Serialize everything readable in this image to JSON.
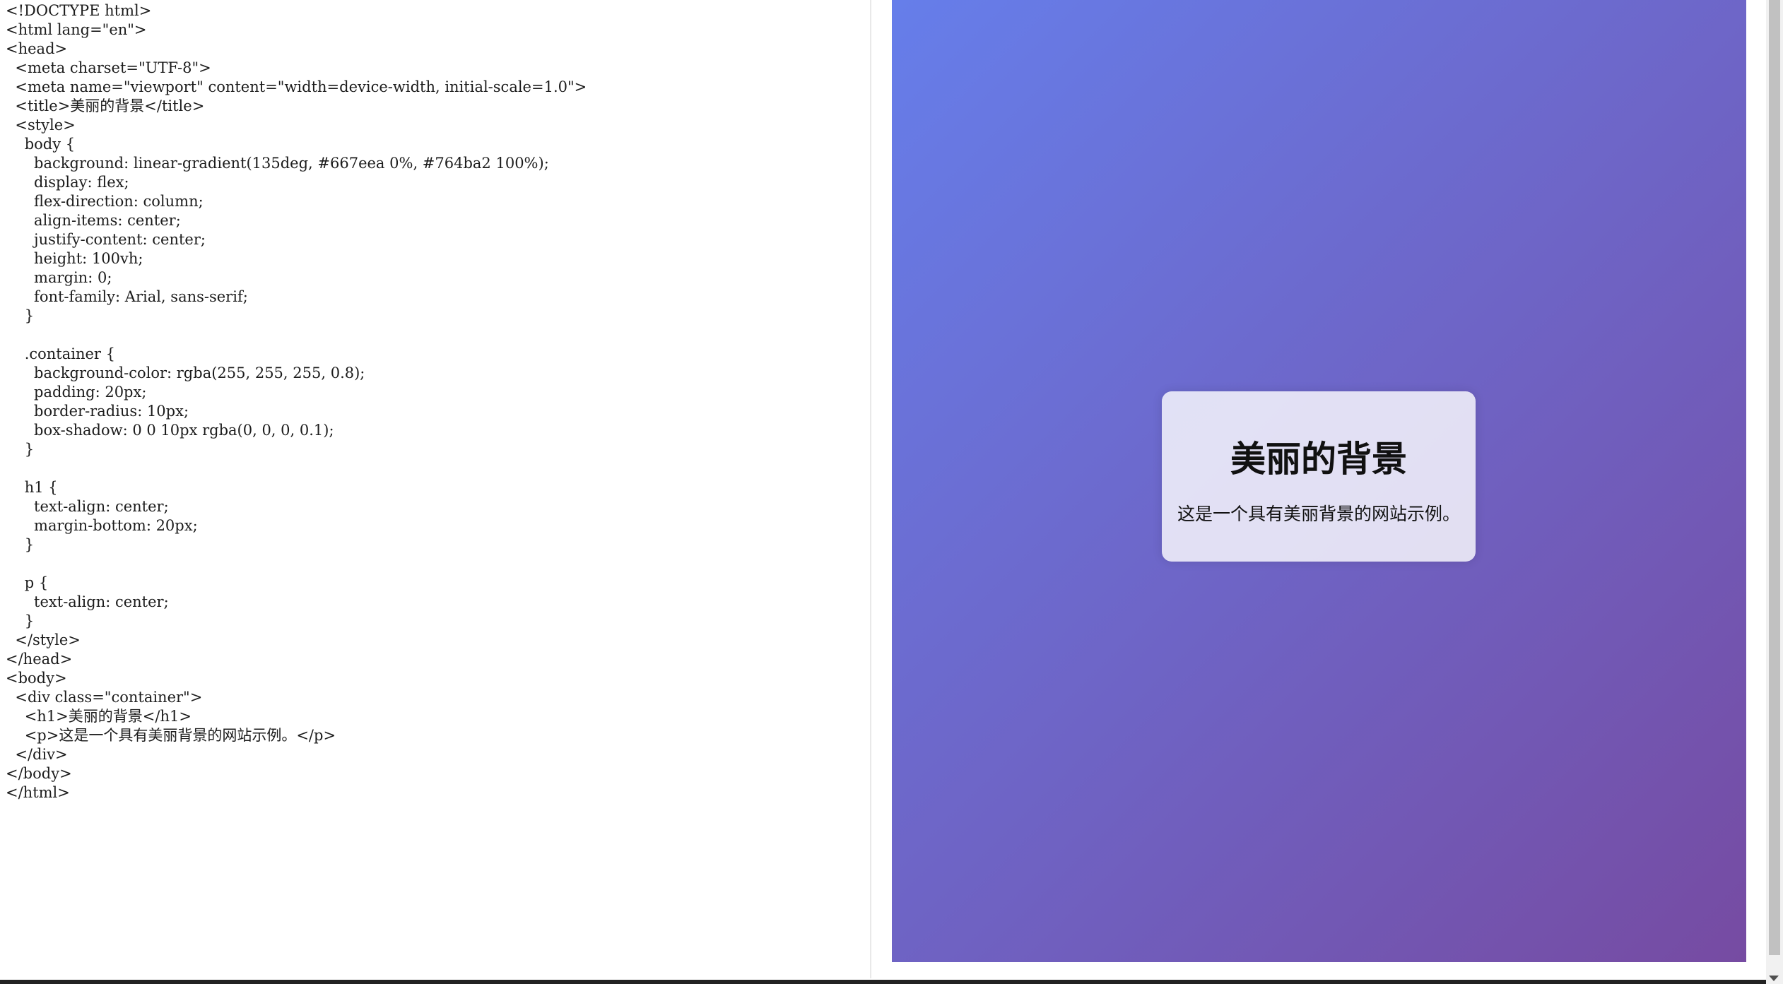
{
  "editor": {
    "lines": [
      "<!DOCTYPE html>",
      "<html lang=\"en\">",
      "<head>",
      "  <meta charset=\"UTF-8\">",
      "  <meta name=\"viewport\" content=\"width=device-width, initial-scale=1.0\">",
      "  <title>美丽的背景</title>",
      "  <style>",
      "    body {",
      "      background: linear-gradient(135deg, #667eea 0%, #764ba2 100%);",
      "      display: flex;",
      "      flex-direction: column;",
      "      align-items: center;",
      "      justify-content: center;",
      "      height: 100vh;",
      "      margin: 0;",
      "      font-family: Arial, sans-serif;",
      "    }",
      "",
      "    .container {",
      "      background-color: rgba(255, 255, 255, 0.8);",
      "      padding: 20px;",
      "      border-radius: 10px;",
      "      box-shadow: 0 0 10px rgba(0, 0, 0, 0.1);",
      "    }",
      "",
      "    h1 {",
      "      text-align: center;",
      "      margin-bottom: 20px;",
      "    }",
      "",
      "    p {",
      "      text-align: center;",
      "    }",
      "  </style>",
      "</head>",
      "<body>",
      "  <div class=\"container\">",
      "    <h1>美丽的背景</h1>",
      "    <p>这是一个具有美丽背景的网站示例。</p>",
      "  </div>",
      "</body>",
      "</html>"
    ]
  },
  "preview": {
    "gradient_start": "#667eea",
    "gradient_end": "#764ba2",
    "card": {
      "title": "美丽的背景",
      "text": "这是一个具有美丽背景的网站示例。"
    }
  },
  "scrollbar": {
    "arrow_icon": "chevron-down-icon"
  }
}
